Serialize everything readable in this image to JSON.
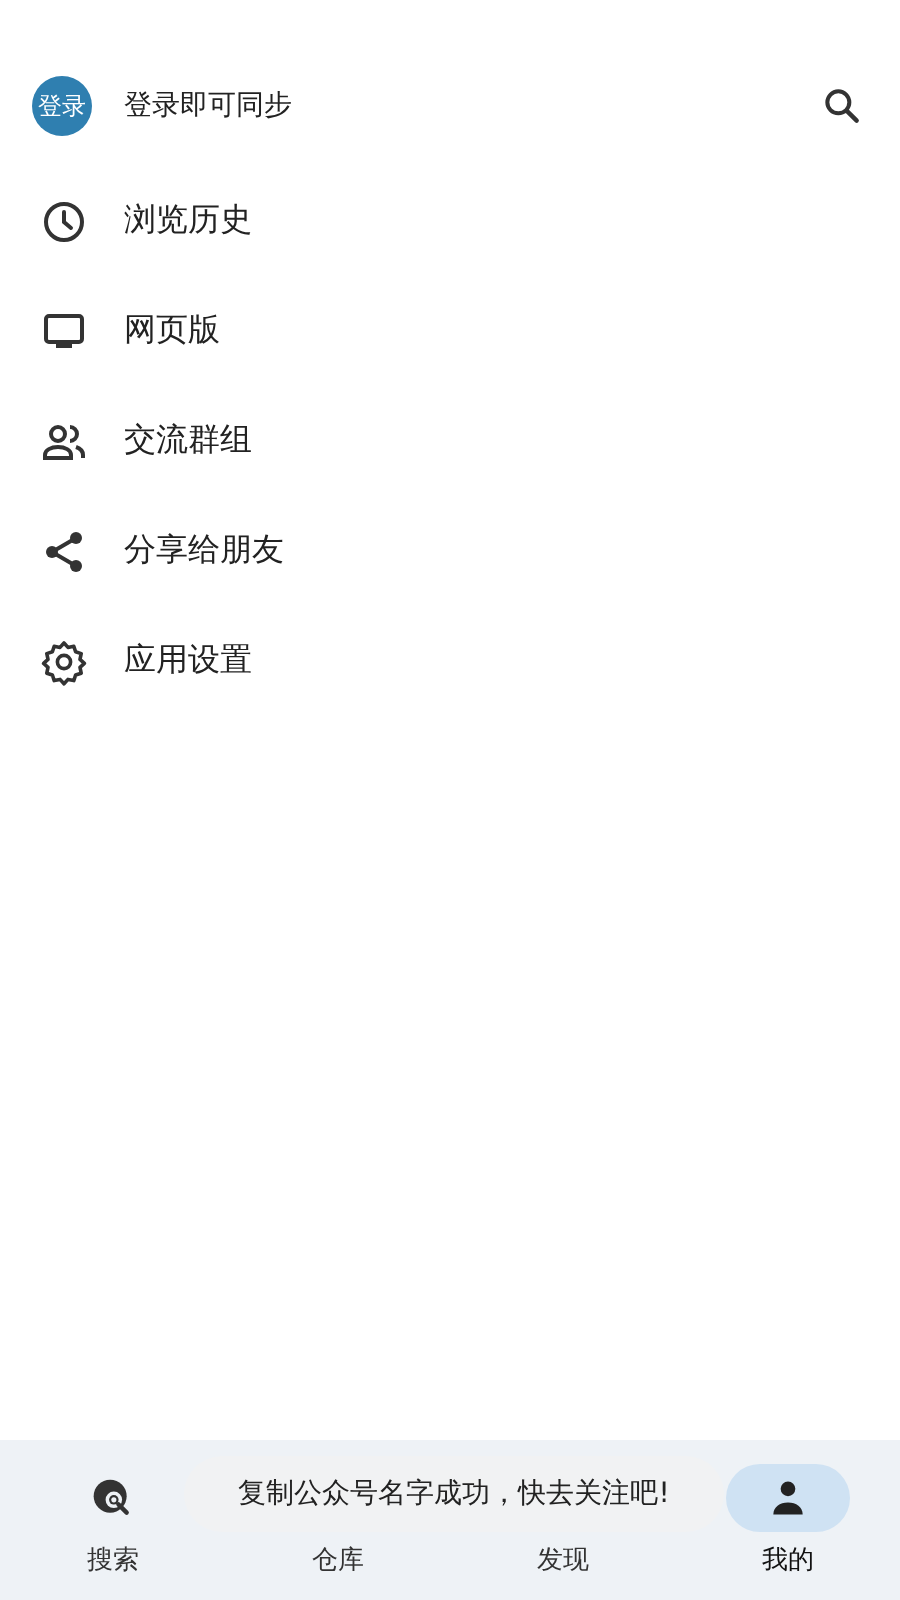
{
  "header": {
    "avatar_text": "登录",
    "title": "登录即可同步"
  },
  "menu": [
    {
      "kind": "history",
      "label": "浏览历史"
    },
    {
      "kind": "web",
      "label": "网页版"
    },
    {
      "kind": "group",
      "label": "交流群组"
    },
    {
      "kind": "share",
      "label": "分享给朋友"
    },
    {
      "kind": "settings",
      "label": "应用设置"
    }
  ],
  "bottom_nav": [
    {
      "kind": "search",
      "label": "搜索",
      "selected": false
    },
    {
      "kind": "hidden",
      "label": "仓库",
      "selected": false
    },
    {
      "kind": "hidden",
      "label": "发现",
      "selected": false
    },
    {
      "kind": "me",
      "label": "我的",
      "selected": true
    }
  ],
  "toast": "复制公众号名字成功，快去关注吧!"
}
